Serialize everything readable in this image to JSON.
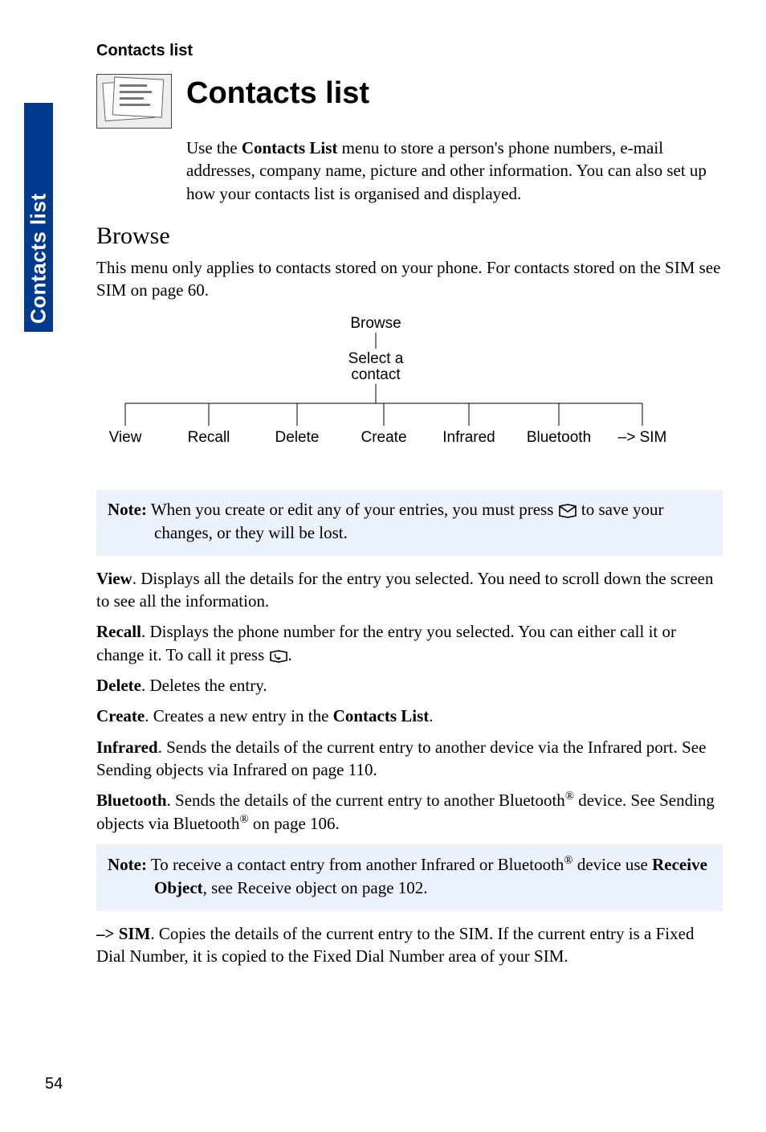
{
  "running_head": "Contacts list",
  "sidebar_label": "Contacts list",
  "page_number": "54",
  "title": "Contacts list",
  "intro_part1": "Use the ",
  "intro_bold1": "Contacts List",
  "intro_part2": " menu to store a person's phone numbers, e-mail addresses, company name, picture and other information. You can also set up how your contacts list is organised and displayed.",
  "section_browse": "Browse",
  "browse_intro": "This menu only applies to contacts stored on your phone. For contacts stored on the SIM see SIM on page 60.",
  "diagram": {
    "root": "Browse",
    "mid": "Select a\ncontact",
    "leaves": [
      "View",
      "Recall",
      "Delete",
      "Create",
      "Infrared",
      "Bluetooth",
      "–> SIM"
    ]
  },
  "note1_label": "Note:",
  "note1_a": " When you create or edit any of your entries, you must press ",
  "note1_b": " to save your changes, or they will be lost.",
  "view_label": "View",
  "view_text": ". Displays all the details for the entry you selected. You need to scroll down the screen to see all the information.",
  "recall_label": "Recall",
  "recall_text_a": ". Displays the phone number for the entry you selected. You can either call it or change it. To call it press ",
  "recall_text_b": ".",
  "delete_label": "Delete",
  "delete_text": ". Deletes the entry.",
  "create_label": "Create",
  "create_text_a": ". Creates a new entry in the ",
  "create_bold": "Contacts List",
  "create_text_b": ".",
  "infrared_label": "Infrared",
  "infrared_text": ". Sends the details of the current entry to another device via the Infrared port. See Sending objects via Infrared on page 110.",
  "bluetooth_label": "Bluetooth",
  "bluetooth_text_a": ". Sends the details of the current entry to another Bluetooth",
  "bluetooth_reg1": "®",
  "bluetooth_text_b": " device. See Sending objects via Bluetooth",
  "bluetooth_reg2": "®",
  "bluetooth_text_c": " on page 106.",
  "note2_label": "Note:",
  "note2_a": " To receive a contact entry from another Infrared or Bluetooth",
  "note2_reg": "®",
  "note2_b": " device use ",
  "note2_bold": "Receive Object",
  "note2_c": ", see Receive object on page 102.",
  "sim_label": "–> SIM",
  "sim_text": ". Copies the details of the current entry to the SIM. If the current entry is a Fixed Dial Number, it is copied to the Fixed Dial Number area of your SIM."
}
